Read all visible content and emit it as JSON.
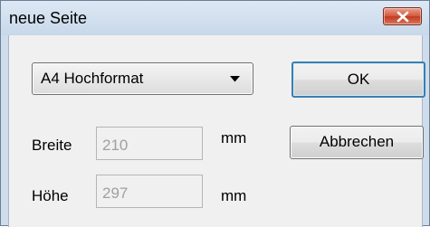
{
  "window": {
    "title": "neue Seite"
  },
  "format": {
    "selected": "A4 Hochformat"
  },
  "buttons": {
    "ok": "OK",
    "cancel": "Abbrechen"
  },
  "width": {
    "label": "Breite",
    "value": "210",
    "unit": "mm"
  },
  "height": {
    "label": "Höhe",
    "value": "297",
    "unit": "mm"
  },
  "icons": {
    "close": "close-icon",
    "dropdown": "chevron-down-icon"
  },
  "colors": {
    "close_button": "#d45a40",
    "default_button_border": "#3c7fb1",
    "frame": "#cfdcec"
  }
}
